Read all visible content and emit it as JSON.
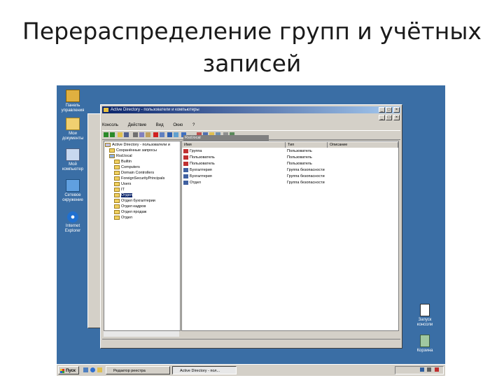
{
  "slide": {
    "title_line1": "Перераспределение групп и учётных",
    "title_line2": "записей"
  },
  "desktop": {
    "icons": [
      {
        "label1": "Панель",
        "label2": "управления"
      },
      {
        "label1": "Мои",
        "label2": "документы"
      },
      {
        "label1": "Мой",
        "label2": "компьютер"
      },
      {
        "label1": "Сетевое",
        "label2": "окружение"
      },
      {
        "label1": "Internet",
        "label2": "Explorer"
      },
      {
        "label1": "Internet",
        "label2": "Explorer"
      }
    ],
    "right_icons": [
      {
        "label1": "Запуск",
        "label2": "консоли"
      },
      {
        "label1": "Корзина",
        "label2": ""
      }
    ]
  },
  "window": {
    "title": "Active Directory - пользователи и компьютеры",
    "menu": [
      "Консоль",
      "Действие",
      "Вид",
      "Окно",
      "?"
    ],
    "tree_header": "Active Directory - пользователи и",
    "tree": [
      "Сохранённые запросы",
      "Rsd.local",
      "Builtin",
      "Computers",
      "Domain Controllers",
      "ForeignSecurityPrincipals",
      "Users",
      "IT",
      "Отдел",
      "Отдел бухгалтерии",
      "Отдел кадров",
      "Отдел продаж",
      "Отдел"
    ],
    "list_header": "Rsd.local",
    "columns": [
      "Имя",
      "Тип",
      "Описание"
    ],
    "rows": [
      {
        "name": "Группа",
        "type": "Пользователь"
      },
      {
        "name": "Пользователь",
        "type": "Пользователь"
      },
      {
        "name": "Пользователь",
        "type": "Пользователь"
      },
      {
        "name": "Бухгалтерия",
        "type": "Группа безопасности"
      },
      {
        "name": "Бухгалтерия",
        "type": "Группа безопасности"
      },
      {
        "name": "Отдел",
        "type": "Группа безопасности"
      }
    ]
  },
  "taskbar": {
    "start": "Пуск",
    "tasks": [
      "Редактор реестра",
      "Active Directory - пол..."
    ]
  },
  "colors": {
    "desktop": "#3a6ea5",
    "titlebar": "#0a246a",
    "chrome": "#d4d0c8"
  }
}
